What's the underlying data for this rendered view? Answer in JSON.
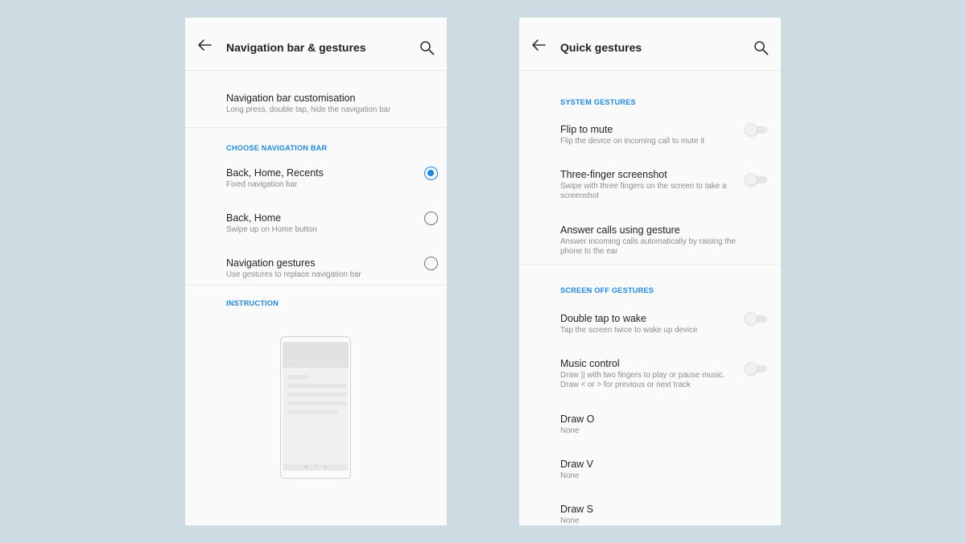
{
  "left": {
    "title": "Navigation bar & gestures",
    "customisation": {
      "title": "Navigation bar customisation",
      "subtitle": "Long press, double tap, hide the navigation bar"
    },
    "choose_label": "CHOOSE NAVIGATION BAR",
    "options": [
      {
        "title": "Back, Home, Recents",
        "subtitle": "Fixed navigation bar",
        "selected": true
      },
      {
        "title": "Back, Home",
        "subtitle": "Swipe up on Home button",
        "selected": false
      },
      {
        "title": "Navigation gestures",
        "subtitle": "Use gestures to replace navigation bar",
        "selected": false
      }
    ],
    "instruction_label": "INSTRUCTION",
    "illustration_nav_glyphs": [
      "◁",
      "○",
      "□"
    ]
  },
  "right": {
    "title": "Quick gestures",
    "system_label": "SYSTEM GESTURES",
    "system_items": [
      {
        "title": "Flip to mute",
        "subtitle": "Flip the device on incoming call to mute it",
        "toggle": false
      },
      {
        "title": "Three-finger screenshot",
        "subtitle": "Swipe with three fingers on the screen to take a screenshot",
        "toggle": false
      },
      {
        "title": "Answer calls using gesture",
        "subtitle": "Answer incoming calls automatically by raising the phone to the ear"
      }
    ],
    "screen_off_label": "SCREEN OFF GESTURES",
    "screen_off_items": [
      {
        "title": "Double tap to wake",
        "subtitle": "Tap the screen twice to wake up device",
        "toggle": false
      },
      {
        "title": "Music control",
        "subtitle": "Draw || with two fingers to play or pause music. Draw < or > for previous or next track",
        "toggle": false
      },
      {
        "title": "Draw O",
        "subtitle": "None"
      },
      {
        "title": "Draw V",
        "subtitle": "None"
      },
      {
        "title": "Draw S",
        "subtitle": "None"
      }
    ]
  },
  "colors": {
    "accent": "#1e88e5",
    "background": "#cddbe3",
    "screen": "#fafafa"
  }
}
